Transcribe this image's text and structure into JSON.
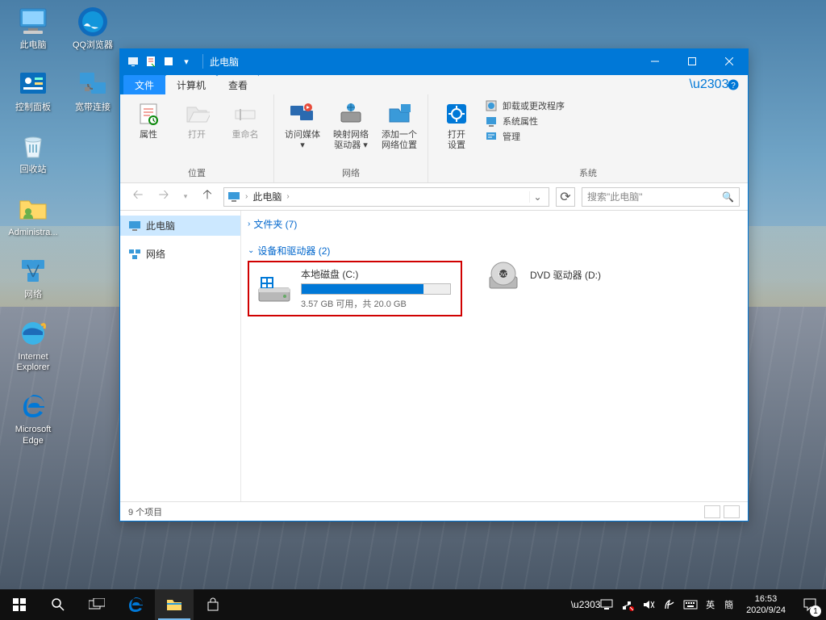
{
  "desktop": {
    "icons_col1": [
      {
        "label": "此电脑",
        "icon": "pc"
      },
      {
        "label": "控制面板",
        "icon": "control-panel"
      },
      {
        "label": "回收站",
        "icon": "recycle-bin"
      },
      {
        "label": "Administra...",
        "icon": "user-folder"
      },
      {
        "label": "网络",
        "icon": "network"
      },
      {
        "label": "Internet Explorer",
        "icon": "ie"
      },
      {
        "label": "Microsoft Edge",
        "icon": "edge"
      }
    ],
    "icons_col2": [
      {
        "label": "QQ浏览器",
        "icon": "qq-browser"
      },
      {
        "label": "宽带连接",
        "icon": "broadband"
      }
    ]
  },
  "window": {
    "title": "此电脑",
    "tabs": {
      "file": "文件",
      "computer": "计算机",
      "view": "查看"
    },
    "ribbon": {
      "groups": [
        {
          "label": "位置",
          "items": [
            {
              "label": "属性",
              "icon": "properties"
            },
            {
              "label": "打开",
              "icon": "open"
            },
            {
              "label": "重命名",
              "icon": "rename"
            }
          ]
        },
        {
          "label": "网络",
          "items": [
            {
              "label": "访问媒体",
              "icon": "media",
              "dropdown": true
            },
            {
              "label": "映射网络\n驱动器",
              "icon": "map-drive",
              "dropdown": true
            },
            {
              "label": "添加一个\n网络位置",
              "icon": "add-network"
            }
          ]
        },
        {
          "label": "系统",
          "open": {
            "label": "打开\n设置",
            "icon": "settings"
          },
          "list": [
            {
              "label": "卸载或更改程序",
              "icon": "uninstall"
            },
            {
              "label": "系统属性",
              "icon": "sys-props"
            },
            {
              "label": "管理",
              "icon": "manage"
            }
          ]
        }
      ]
    },
    "nav": {
      "breadcrumb": "此电脑",
      "search_placeholder": "搜索\"此电脑\""
    },
    "tree": [
      {
        "label": "此电脑",
        "icon": "pc",
        "selected": true
      },
      {
        "label": "网络",
        "icon": "network"
      }
    ],
    "sections": {
      "folders": {
        "label": "文件夹 (7)",
        "expanded": false
      },
      "devices": {
        "label": "设备和驱动器 (2)",
        "expanded": true
      }
    },
    "drives": [
      {
        "name": "本地磁盘 (C:)",
        "space": "3.57 GB 可用，共 20.0 GB",
        "fill_pct": 82,
        "color": "#0078d7",
        "highlighted": true,
        "icon": "hdd-win"
      },
      {
        "name": "DVD 驱动器 (D:)",
        "space": "",
        "fill_pct": 0,
        "icon": "dvd"
      }
    ],
    "status": "9 个项目"
  },
  "taskbar": {
    "time": "16:53",
    "date": "2020/9/24",
    "ime1": "英",
    "ime2": "簡",
    "notif_count": "1"
  }
}
